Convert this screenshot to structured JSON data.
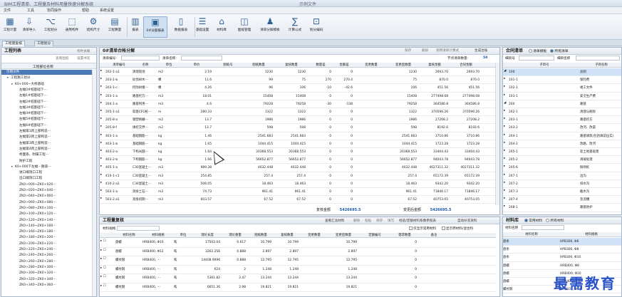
{
  "window": {
    "title": "BIM工程清单、工程量及材料用量快速分解系统",
    "center_title": "示例文件"
  },
  "menu": [
    "文件",
    "工具",
    "协同操作",
    "帮助",
    "系统设置"
  ],
  "ribbon": [
    {
      "label": "工程计量",
      "icon": "calc-icon"
    },
    {
      "label": "清单导入",
      "icon": "import-icon"
    },
    {
      "label": "工程划分",
      "icon": "split-icon"
    },
    {
      "label": "通用构件",
      "icon": "component-icon"
    },
    {
      "label": "结构尺寸",
      "icon": "structure-icon"
    },
    {
      "label": "工程算量",
      "icon": "measure-icon"
    },
    {
      "label": "报表",
      "icon": "report-icon"
    },
    {
      "label": "0#分部报表",
      "icon": "table-icon"
    },
    {
      "label": "数据报表",
      "icon": "doc-icon"
    },
    {
      "label": "基础设置",
      "icon": "settings-icon"
    },
    {
      "label": "材料库",
      "icon": "home-icon"
    },
    {
      "label": "图纸管理",
      "icon": "drawing-icon"
    },
    {
      "label": "清单分解模板",
      "icon": "template-icon"
    },
    {
      "label": "计算公式",
      "icon": "formula-icon"
    },
    {
      "label": "划分编码",
      "icon": "code-icon"
    }
  ],
  "tabs": [
    "工程量复核",
    "工程划分"
  ],
  "left_panel": {
    "title": "工程列表",
    "toolbar": [
      "构件关联",
      "查看图纸",
      "设置书签"
    ],
    "column": "工程部位名称",
    "items": [
      {
        "text": "示例文件",
        "level": 0,
        "sel": true
      },
      {
        "text": "工程施工划分",
        "level": 1
      },
      {
        "text": "K0+000~大桥基础",
        "level": 2
      },
      {
        "text": "左幅0#桩基础下⋯",
        "level": 3
      },
      {
        "text": "左幅1#桩基础下⋯",
        "level": 3
      },
      {
        "text": "左幅2#桩基础下⋯",
        "level": 3
      },
      {
        "text": "左幅3#桩基础下⋯",
        "level": 3
      },
      {
        "text": "左幅4#桩基础下⋯",
        "level": 3
      },
      {
        "text": "左幅5#桩基础下⋯",
        "level": 3
      },
      {
        "text": "左幅6#桩基础下⋯",
        "level": 3
      },
      {
        "text": "左幅第1跨上部构造⋯",
        "level": 3
      },
      {
        "text": "左幅第2跨上部构造⋯",
        "level": 3
      },
      {
        "text": "左幅第3跨上部构造⋯",
        "level": 3
      },
      {
        "text": "左幅第4跨上部构造⋯",
        "level": 3
      },
      {
        "text": "桥面系、附属工程⋯",
        "level": 3
      },
      {
        "text": "防护工程",
        "level": 3
      },
      {
        "text": "K0+000下左幅⋯隧道⋯",
        "level": 2
      },
      {
        "text": "进口端洞口工程",
        "level": 3
      },
      {
        "text": "出口端洞口工程",
        "level": 3
      },
      {
        "text": "ZK0+000~ZK0+020⋯",
        "level": 3
      },
      {
        "text": "ZK0+020~ZK0+040⋯",
        "level": 3
      },
      {
        "text": "ZK0+040~ZK0+060⋯",
        "level": 3
      },
      {
        "text": "ZK0+060~ZK0+080⋯",
        "level": 3
      },
      {
        "text": "ZK0+080~ZK0+100⋯",
        "level": 3
      },
      {
        "text": "ZK0+100~ZK0+120⋯",
        "level": 3
      },
      {
        "text": "ZK0+120~ZK0+140⋯",
        "level": 3
      },
      {
        "text": "ZK0+140~ZK0+160⋯",
        "level": 3
      },
      {
        "text": "ZK0+160~ZK0+180⋯",
        "level": 3
      },
      {
        "text": "ZK0+180~ZK0+200⋯",
        "level": 3
      },
      {
        "text": "ZK0+200~ZK0+220⋯",
        "level": 3
      },
      {
        "text": "ZK0+220~ZK0+240⋯",
        "level": 3
      },
      {
        "text": "ZK0+240~ZK0+260⋯",
        "level": 3
      },
      {
        "text": "ZK0+260~ZK0+280⋯",
        "level": 3
      },
      {
        "text": "ZK0+280~ZK0+300⋯",
        "level": 3
      },
      {
        "text": "ZK0+300~ZK0+320⋯",
        "level": 3
      },
      {
        "text": "ZK0+320~ZK0+340⋯",
        "level": 3
      },
      {
        "text": "ZK0+340~ZK0+360⋯",
        "level": 3
      }
    ]
  },
  "main_panel": {
    "title": "0#清单台帐分解",
    "actions": [
      "保存",
      "删除",
      "调用清单计算式",
      "生成台账"
    ],
    "filter_label_1": "清单编号:",
    "filter_label_2": "清单名称:",
    "node_count_label": "节点清单数量:",
    "node_count_value": "50",
    "columns": [
      "清单编号",
      "名称",
      "单位",
      "单价",
      "图纸号",
      "图纸数量",
      "复核数量",
      "数量差",
      "金额差",
      "变更数量",
      "变更后数量",
      "复核金额",
      "合同金额"
    ],
    "rows": [
      [
        "202-1-a1",
        "清理现场",
        "m2",
        "2.19",
        "",
        "1230",
        "1230",
        "0",
        "0",
        "",
        "1230",
        "2693.70",
        "2693.70"
      ],
      [
        "203-1-b",
        "砍伐树木⋯",
        "棵",
        "11.6",
        "",
        "99",
        "75",
        "270",
        "270.4",
        "",
        "75",
        "870.0",
        "870.0"
      ],
      [
        "203-1-c",
        "挖除树根⋯",
        "棵",
        "4.26",
        "",
        "96",
        "106",
        "-10",
        "-42.6",
        "",
        "106",
        "451.56",
        "451.56"
      ],
      [
        "203-1-a",
        "路基挖方⋯",
        "m3",
        "18.01",
        "",
        "15408",
        "15408",
        "0",
        "0",
        "",
        "15408",
        "277498.08",
        "277498.08"
      ],
      [
        "204-1-a",
        "路基利用⋯",
        "m3",
        "4.6",
        "",
        "79228",
        "79258",
        "-30",
        "-138",
        "",
        "79258",
        "364586.8",
        "364586.8"
      ],
      [
        "205-1-a1",
        "软基CFG桩⋯",
        "m",
        "280.33",
        "",
        "1322",
        "1322",
        "0",
        "0",
        "",
        "1322",
        "370596.26",
        "370596.26"
      ],
      [
        "205-8-a",
        "钢塑格栅⋯",
        "m2",
        "13.7",
        "",
        "1986",
        "1986",
        "0",
        "0",
        "",
        "1986",
        "27208.2",
        "27208.2"
      ],
      [
        "205-8-f",
        "填挖交界⋯",
        "m2",
        "13.7",
        "",
        "598",
        "598",
        "0",
        "0",
        "",
        "598",
        "8192.6",
        "8192.6"
      ],
      [
        "403-1-a",
        "基础钢筋⋯",
        "kg",
        "1.46",
        "",
        "2541.683",
        "2541.683",
        "0",
        "0",
        "",
        "2541.683",
        "3710.86",
        "3710.86"
      ],
      [
        "403-1-b",
        "基础钢筋⋯",
        "kg",
        "1.65",
        "",
        "1044.415",
        "1044.415",
        "0",
        "0",
        "",
        "1044.415",
        "1723.28",
        "1723.28"
      ],
      [
        "403-2-a",
        "下构光圆⋯",
        "kg",
        "1.64",
        "",
        "20368.553",
        "20368.553",
        "0",
        "0",
        "",
        "20368.553",
        "33404.43",
        "33404.43"
      ],
      [
        "403-2-b",
        "下构钢筋⋯",
        "kg",
        "1.66",
        "",
        "56652.877",
        "56652.877",
        "0",
        "0",
        "",
        "56652.877",
        "94043.78",
        "94043.78"
      ],
      [
        "405-1-a",
        "C30混凝土⋯",
        "m3",
        "989.38",
        "",
        "4632.448",
        "4632.448",
        "0",
        "0",
        "",
        "4632.448",
        "4027311.32",
        "4027311.32"
      ],
      [
        "410-1-c1",
        "C30混凝土⋯",
        "m3",
        "254.85",
        "",
        "257.4",
        "257.4",
        "0",
        "0",
        "",
        "257.4",
        "65172.39",
        "65172.39"
      ],
      [
        "410-2-a1",
        "C30混凝土⋯",
        "m3",
        "506.05",
        "",
        "18.463",
        "18.463",
        "0",
        "0",
        "",
        "18.463",
        "9342.20",
        "9342.20"
      ],
      [
        "503-1-a",
        "洞身土石⋯",
        "m3",
        "74.73",
        "",
        "961.41",
        "961.41",
        "0",
        "0",
        "",
        "961.41",
        "71846.17",
        "71846.17"
      ],
      [
        "503-2-a1",
        "洞身初期⋯",
        "m3",
        "603.57",
        "",
        "67.52",
        "67.52",
        "0",
        "0",
        "",
        "67.52",
        "40753.05",
        "40753.05"
      ]
    ],
    "total1_label": "复核金额",
    "total1_value": "5426695.5",
    "total2_label": "变更后金额",
    "total2_value": "5426695.5"
  },
  "contract_panel": {
    "title": "合同清单",
    "radio1": "清单模板",
    "radio2": "所有清单",
    "label1": "细目号",
    "label2": "细目名称",
    "columns": [
      "子目号",
      "子目名称"
    ],
    "rows": [
      [
        "100",
        "总则"
      ],
      [
        "101-1",
        "保险费"
      ],
      [
        "102-1",
        "竣工文件"
      ],
      [
        "103-1",
        "安全生产费"
      ],
      [
        "200",
        "路基"
      ],
      [
        "202-1",
        "清理与掘除"
      ],
      [
        "203-1",
        "路基挖方"
      ],
      [
        "203-2",
        "改河、改渠"
      ],
      [
        "204-1",
        "路基填筑(包括填前压实)"
      ],
      [
        "204-2",
        "改路、改河"
      ],
      [
        "205-1",
        "软土地基处理"
      ],
      [
        "205-2",
        "滑坡处理"
      ],
      [
        "205-6",
        "粉喷桩"
      ],
      [
        "207-1",
        "边沟"
      ],
      [
        "207-2",
        "排水沟"
      ],
      [
        "207-3",
        "截水沟"
      ],
      [
        "207-4",
        "急流槽"
      ],
      [
        "208-1",
        "路基防护"
      ]
    ]
  },
  "review_panel": {
    "title": "工程量复核",
    "actions": [
      "查看汇总材料",
      "删除",
      "粘贴",
      "保存",
      "填写",
      "经验/定额材料系数参照表",
      "自动补充资料"
    ],
    "label": "材料规格",
    "option1": "仅显示常用材料",
    "option2": "显示原材料/混合料",
    "columns": [
      "材料名称",
      "材料规格",
      "单位",
      "理论长度",
      "理论重量",
      "图纸数量",
      "复核数量",
      "变更数量",
      "变更后数量",
      "定额编号",
      "需求数量",
      "备注"
    ],
    "rows": [
      [
        "盘螺",
        "HRB400, Φ10",
        "吨",
        "17502.04",
        "0.617",
        "10.799",
        "10.799",
        "",
        "10.799",
        "",
        "0",
        ""
      ],
      [
        "盘螺",
        "HRB400, Φ12",
        "吨",
        "3262.256",
        "0.888",
        "2.897",
        "2.897",
        "",
        "2.897",
        "",
        "0",
        ""
      ],
      [
        "螺纹钢",
        "HRB400, ⋯",
        "吨",
        "14408.9096",
        "0.888",
        "12.795",
        "12.795",
        "",
        "12.795",
        "",
        "0",
        ""
      ],
      [
        "螺纹钢",
        "HRB400, ⋯",
        "吨",
        "624",
        "2",
        "1.248",
        "1.248",
        "",
        "1.248",
        "",
        "0",
        ""
      ],
      [
        "螺纹钢",
        "HRB400, ⋯",
        "吨",
        "5361.82",
        "2.47",
        "13.244",
        "13.244",
        "",
        "13.244",
        "",
        "0",
        ""
      ],
      [
        "螺纹钢",
        "HRB400, ⋯",
        "吨",
        "6651.36",
        "2.98",
        "19.821",
        "19.821",
        "",
        "19.821",
        "",
        "0",
        ""
      ]
    ]
  },
  "material_panel": {
    "title": "材料库",
    "radio1": "常用材料",
    "radio2": "所有材料",
    "label": "材料名称",
    "columns": [
      "材料名称",
      "材料规格"
    ],
    "rows": [
      [
        "盘条",
        "HPB300, Φ6"
      ],
      [
        "盘条",
        "HPB300, Φ8"
      ],
      [
        "盘条",
        "HPB300, Φ10"
      ],
      [
        "盘螺",
        "HRB400, Φ8"
      ],
      [
        "盘螺",
        "HRB400, Φ10"
      ],
      [
        "盘螺",
        "HRB400, Φ12"
      ],
      [
        "螺纹钢",
        "HRB335, Φ14"
      ]
    ]
  },
  "watermark": "最需教育"
}
